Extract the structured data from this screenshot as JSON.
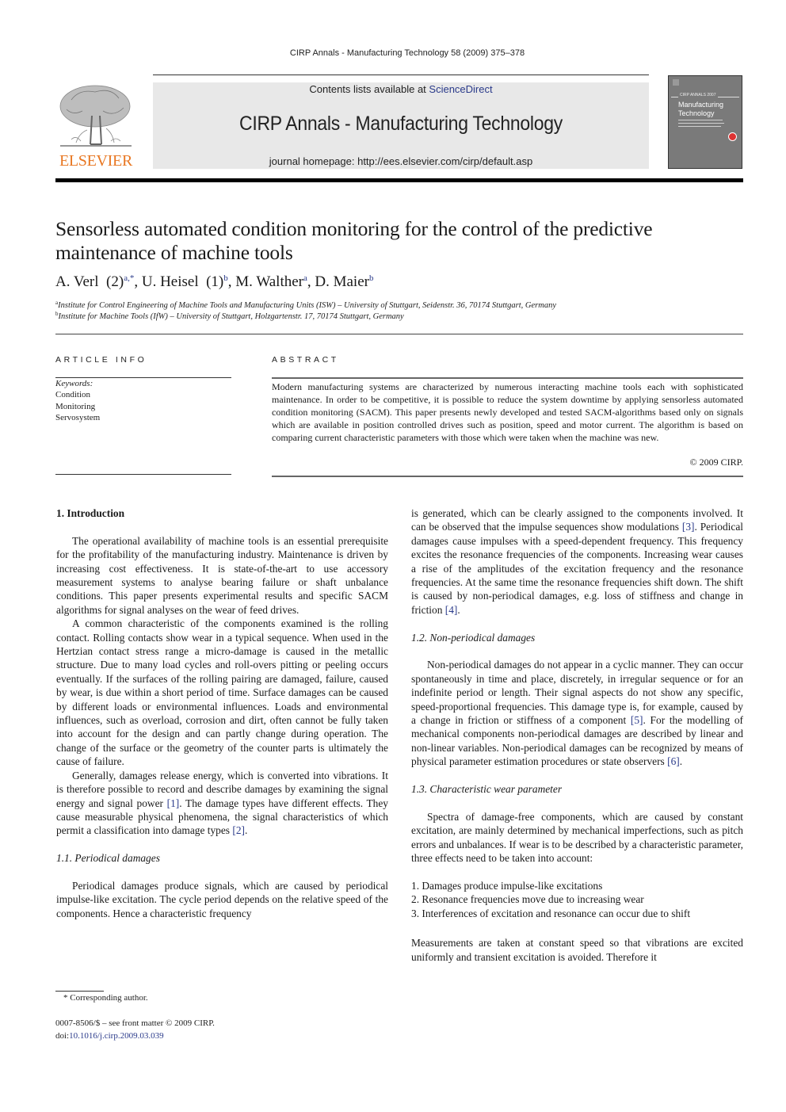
{
  "running_head": "CIRP Annals - Manufacturing Technology 58 (2009) 375–378",
  "masthead": {
    "publisher_logo": "ELSEVIER",
    "contents_prefix": "Contents lists available at ",
    "contents_link": "ScienceDirect",
    "journal_title": "CIRP Annals - Manufacturing Technology",
    "homepage_prefix": "journal homepage: ",
    "homepage_url": "http://ees.elsevier.com/cirp/default.asp",
    "cover": {
      "series": "CIRP ANNALS 2007",
      "title_line1": "Manufacturing",
      "title_line2": "Technology"
    }
  },
  "article": {
    "title": "Sensorless automated condition monitoring for the control of the predictive maintenance of machine tools",
    "authors": [
      {
        "name": "A. Verl",
        "member": "(2)",
        "sup": "a,*"
      },
      {
        "name": "U. Heisel",
        "member": "(1)",
        "sup": "b"
      },
      {
        "name": "M. Walther",
        "member": "",
        "sup": "a"
      },
      {
        "name": "D. Maier",
        "member": "",
        "sup": "b"
      }
    ],
    "affiliations": [
      {
        "mark": "a",
        "text": "Institute for Control Engineering of Machine Tools and Manufacturing Units (ISW) – University of Stuttgart, Seidenstr. 36, 70174 Stuttgart, Germany"
      },
      {
        "mark": "b",
        "text": "Institute for Machine Tools (IfW) – University of Stuttgart, Holzgartenstr. 17, 70174 Stuttgart, Germany"
      }
    ]
  },
  "article_info": {
    "heading": "ARTICLE INFO",
    "keywords_label": "Keywords:",
    "keywords": [
      "Condition",
      "Monitoring",
      "Servosystem"
    ]
  },
  "abstract": {
    "heading": "ABSTRACT",
    "text": "Modern manufacturing systems are characterized by numerous interacting machine tools each with sophisticated maintenance. In order to be competitive, it is possible to reduce the system downtime by applying sensorless automated condition monitoring (SACM). This paper presents newly developed and tested SACM-algorithms based only on signals which are available in position controlled drives such as position, speed and motor current. The algorithm is based on comparing current characteristic parameters with those which were taken when the machine was new.",
    "copyright": "© 2009 CIRP."
  },
  "body": {
    "section1_heading": "1.  Introduction",
    "intro_p1": "The operational availability of machine tools is an essential prerequisite for the profitability of the manufacturing industry. Maintenance is driven by increasing cost effectiveness. It is state-of-the-art to use accessory measurement systems to analyse bearing failure or shaft unbalance conditions. This paper presents experimental results and specific SACM algorithms for signal analyses on the wear of feed drives.",
    "intro_p2": "A common characteristic of the components examined is the rolling contact. Rolling contacts show wear in a typical sequence. When used in the Hertzian contact stress range a micro-damage is caused in the metallic structure. Due to many load cycles and roll-overs pitting or peeling occurs eventually. If the surfaces of the rolling pairing are damaged, failure, caused by wear, is due within a short period of time. Surface damages can be caused by different loads or environmental influences. Loads and environmental influences, such as overload, corrosion and dirt, often cannot be fully taken into account for the design and can partly change during operation. The change of the surface or the geometry of the counter parts is ultimately the cause of failure.",
    "intro_p3_a": "Generally, damages release energy, which is converted into vibrations. It is therefore possible to record and describe damages by examining the signal energy and signal power ",
    "intro_p3_ref1": "[1]",
    "intro_p3_b": ". The damage types have different effects. They cause measurable physical phenomena, the signal characteristics of which permit a classification into damage types ",
    "intro_p3_ref2": "[2]",
    "intro_p3_c": ".",
    "section1_1_heading": "1.1.  Periodical damages",
    "periodical_a": "Periodical damages produce signals, which are caused by periodical impulse-like excitation. The cycle period depends on the relative speed of the components. Hence a characteristic frequency is generated, which can be clearly assigned to the components involved. It can be observed that the impulse sequences show modulations ",
    "periodical_ref3": "[3]",
    "periodical_b": ". Periodical damages cause impulses with a speed-dependent frequency. This frequency excites the resonance frequencies of the components. Increasing wear causes a rise of the amplitudes of the excitation frequency and the resonance frequencies. At the same time the resonance frequencies shift down. The shift is caused by non-periodical damages, e.g. loss of stiffness and change in friction ",
    "periodical_ref4": "[4]",
    "periodical_c": ".",
    "section1_2_heading": "1.2.  Non-periodical damages",
    "nonperiodical_a": "Non-periodical damages do not appear in a cyclic manner. They can occur spontaneously in time and place, discretely, in irregular sequence or for an indefinite period or length. Their signal aspects do not show any specific, speed-proportional frequencies. This damage type is, for example, caused by a change in friction or stiffness of a component ",
    "nonperiodical_ref5": "[5]",
    "nonperiodical_b": ". For the modelling of mechanical components non-periodical damages are described by linear and non-linear variables. Non-periodical damages can be recognized by means of physical parameter estimation procedures or state observers ",
    "nonperiodical_ref6": "[6]",
    "nonperiodical_c": ".",
    "section1_3_heading": "1.3.  Characteristic wear parameter",
    "wear_p1": "Spectra of damage-free components, which are caused by constant excitation, are mainly determined by mechanical imperfections, such as pitch errors and unbalances. If wear is to be described by a characteristic parameter, three effects need to be taken into account:",
    "wear_list": [
      "1. Damages produce impulse-like excitations",
      "2. Resonance frequencies move due to increasing wear",
      "3. Interferences of excitation and resonance can occur due to shift"
    ],
    "wear_p2": "Measurements are taken at constant speed so that vibrations are excited uniformly and transient excitation is avoided. Therefore it"
  },
  "footer": {
    "footnote": "* Corresponding author.",
    "front_matter": "0007-8506/$ – see front matter © 2009 CIRP.",
    "doi_prefix": "doi:",
    "doi": "10.1016/j.cirp.2009.03.039"
  },
  "colors": {
    "link": "#2a3a8a",
    "elsevier_orange": "#e87722",
    "masthead_bg": "#e8e8e8",
    "cover_bg": "#7a7a7a"
  }
}
